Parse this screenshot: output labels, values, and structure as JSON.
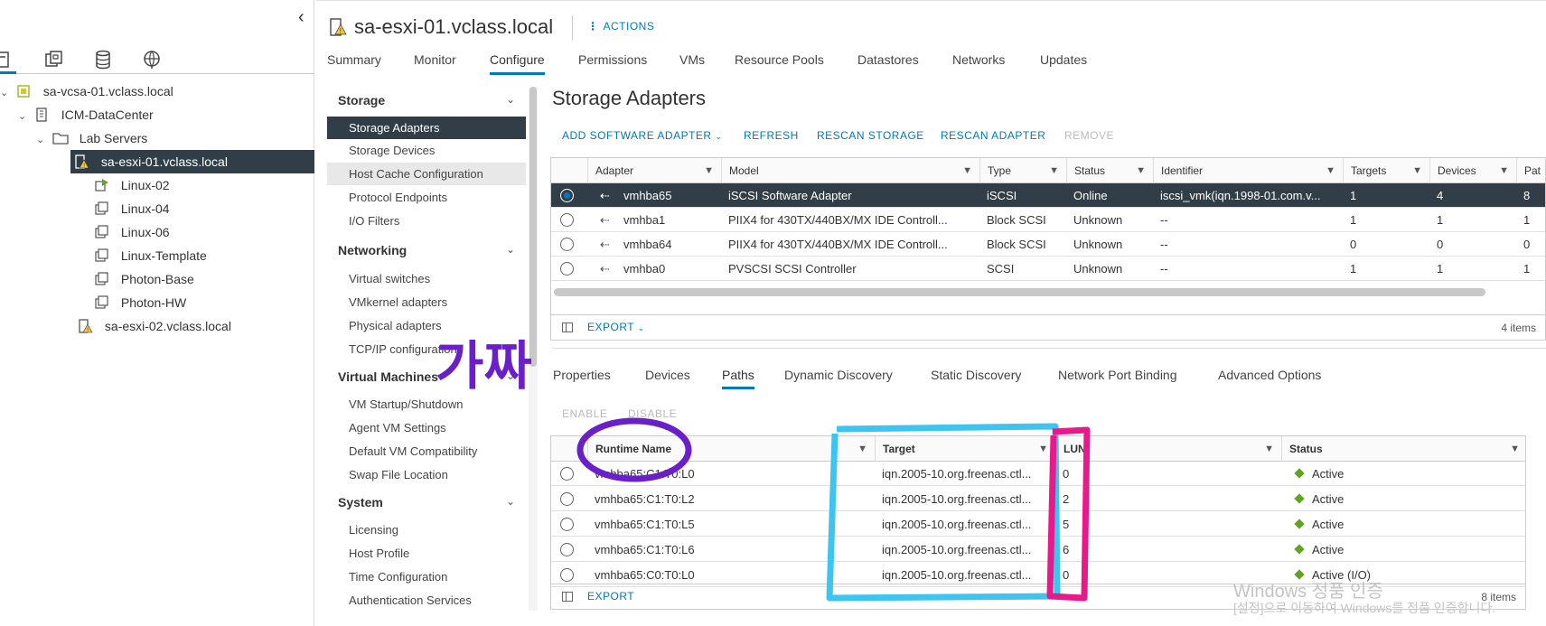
{
  "inventory": {
    "tabs": [
      "hosts-clusters-icon",
      "vms-templates-icon",
      "storage-icon",
      "networking-icon"
    ],
    "tree": [
      {
        "label": "sa-vcsa-01.vclass.local",
        "icon": "vcenter-icon"
      },
      {
        "label": "ICM-DataCenter",
        "icon": "datacenter-icon"
      },
      {
        "label": "Lab Servers",
        "icon": "folder-icon"
      },
      {
        "label": "sa-esxi-01.vclass.local",
        "icon": "host-warning-icon"
      },
      {
        "label": "Linux-02",
        "icon": "vm-running-icon"
      },
      {
        "label": "Linux-04",
        "icon": "vm-icon"
      },
      {
        "label": "Linux-06",
        "icon": "vm-icon"
      },
      {
        "label": "Linux-Template",
        "icon": "vm-icon"
      },
      {
        "label": "Photon-Base",
        "icon": "vm-icon"
      },
      {
        "label": "Photon-HW",
        "icon": "vm-icon"
      },
      {
        "label": "sa-esxi-02.vclass.local",
        "icon": "host-warning-icon"
      }
    ]
  },
  "header": {
    "title": "sa-esxi-01.vclass.local",
    "actions": "ACTIONS",
    "tabs": [
      "Summary",
      "Monitor",
      "Configure",
      "Permissions",
      "VMs",
      "Resource Pools",
      "Datastores",
      "Networks",
      "Updates"
    ],
    "active_tab": "Configure"
  },
  "config_menu": {
    "sections": [
      {
        "title": "Storage",
        "items": [
          "Storage Adapters",
          "Storage Devices",
          "Host Cache Configuration",
          "Protocol Endpoints",
          "I/O Filters"
        ]
      },
      {
        "title": "Networking",
        "items": [
          "Virtual switches",
          "VMkernel adapters",
          "Physical adapters",
          "TCP/IP configuration"
        ]
      },
      {
        "title": "Virtual Machines",
        "items": [
          "VM Startup/Shutdown",
          "Agent VM Settings",
          "Default VM Compatibility",
          "Swap File Location"
        ]
      },
      {
        "title": "System",
        "items": [
          "Licensing",
          "Host Profile",
          "Time Configuration",
          "Authentication Services"
        ]
      }
    ],
    "selected": "Storage Adapters"
  },
  "main": {
    "title": "Storage Adapters",
    "toolbar": {
      "add": "ADD SOFTWARE ADAPTER",
      "refresh": "REFRESH",
      "rescan_storage": "RESCAN STORAGE",
      "rescan_adapter": "RESCAN ADAPTER",
      "remove": "REMOVE"
    },
    "adapters": {
      "columns": [
        "Adapter",
        "Model",
        "Type",
        "Status",
        "Identifier",
        "Targets",
        "Devices",
        "Pat"
      ],
      "rows": [
        [
          "vmhba65",
          "iSCSI Software Adapter",
          "iSCSI",
          "Online",
          "iscsi_vmk(iqn.1998-01.com.v...",
          "1",
          "4",
          "8"
        ],
        [
          "vmhba1",
          "PIIX4 for 430TX/440BX/MX IDE Controll...",
          "Block SCSI",
          "Unknown",
          "--",
          "1",
          "1",
          "1"
        ],
        [
          "vmhba64",
          "PIIX4 for 430TX/440BX/MX IDE Controll...",
          "Block SCSI",
          "Unknown",
          "--",
          "0",
          "0",
          "0"
        ],
        [
          "vmhba0",
          "PVSCSI SCSI Controller",
          "SCSI",
          "Unknown",
          "--",
          "1",
          "1",
          "1"
        ]
      ],
      "export": "EXPORT",
      "count": "4 items"
    },
    "subtabs": [
      "Properties",
      "Devices",
      "Paths",
      "Dynamic Discovery",
      "Static Discovery",
      "Network Port Binding",
      "Advanced Options"
    ],
    "active_subtab": "Paths",
    "path_buttons": {
      "enable": "ENABLE",
      "disable": "DISABLE"
    },
    "paths": {
      "columns": [
        "Runtime Name",
        "Target",
        "LUN",
        "Status"
      ],
      "rows": [
        [
          "vmhba65:C1:T0:L0",
          "iqn.2005-10.org.freenas.ctl...",
          "0",
          "Active"
        ],
        [
          "vmhba65:C1:T0:L2",
          "iqn.2005-10.org.freenas.ctl...",
          "2",
          "Active"
        ],
        [
          "vmhba65:C1:T0:L5",
          "iqn.2005-10.org.freenas.ctl...",
          "5",
          "Active"
        ],
        [
          "vmhba65:C1:T0:L6",
          "iqn.2005-10.org.freenas.ctl...",
          "6",
          "Active"
        ],
        [
          "vmhba65:C0:T0:L0",
          "iqn.2005-10.org.freenas.ctl...",
          "0",
          "Active (I/O)"
        ]
      ],
      "export": "EXPORT",
      "count": "8 items"
    }
  },
  "annotation": {
    "text": "가짜",
    "colors": {
      "purple": "#6a1fc9",
      "cyan": "#3ec4f0",
      "pink": "#e8198b"
    }
  },
  "watermark": {
    "line1": "Windows 정품 인증",
    "line2": "[설정]으로 이동하여 Windows를 정품 인증합니다."
  },
  "colors": {
    "accent": "#0079b8",
    "selected_bg": "#313e47",
    "status_ok": "#62a420"
  }
}
